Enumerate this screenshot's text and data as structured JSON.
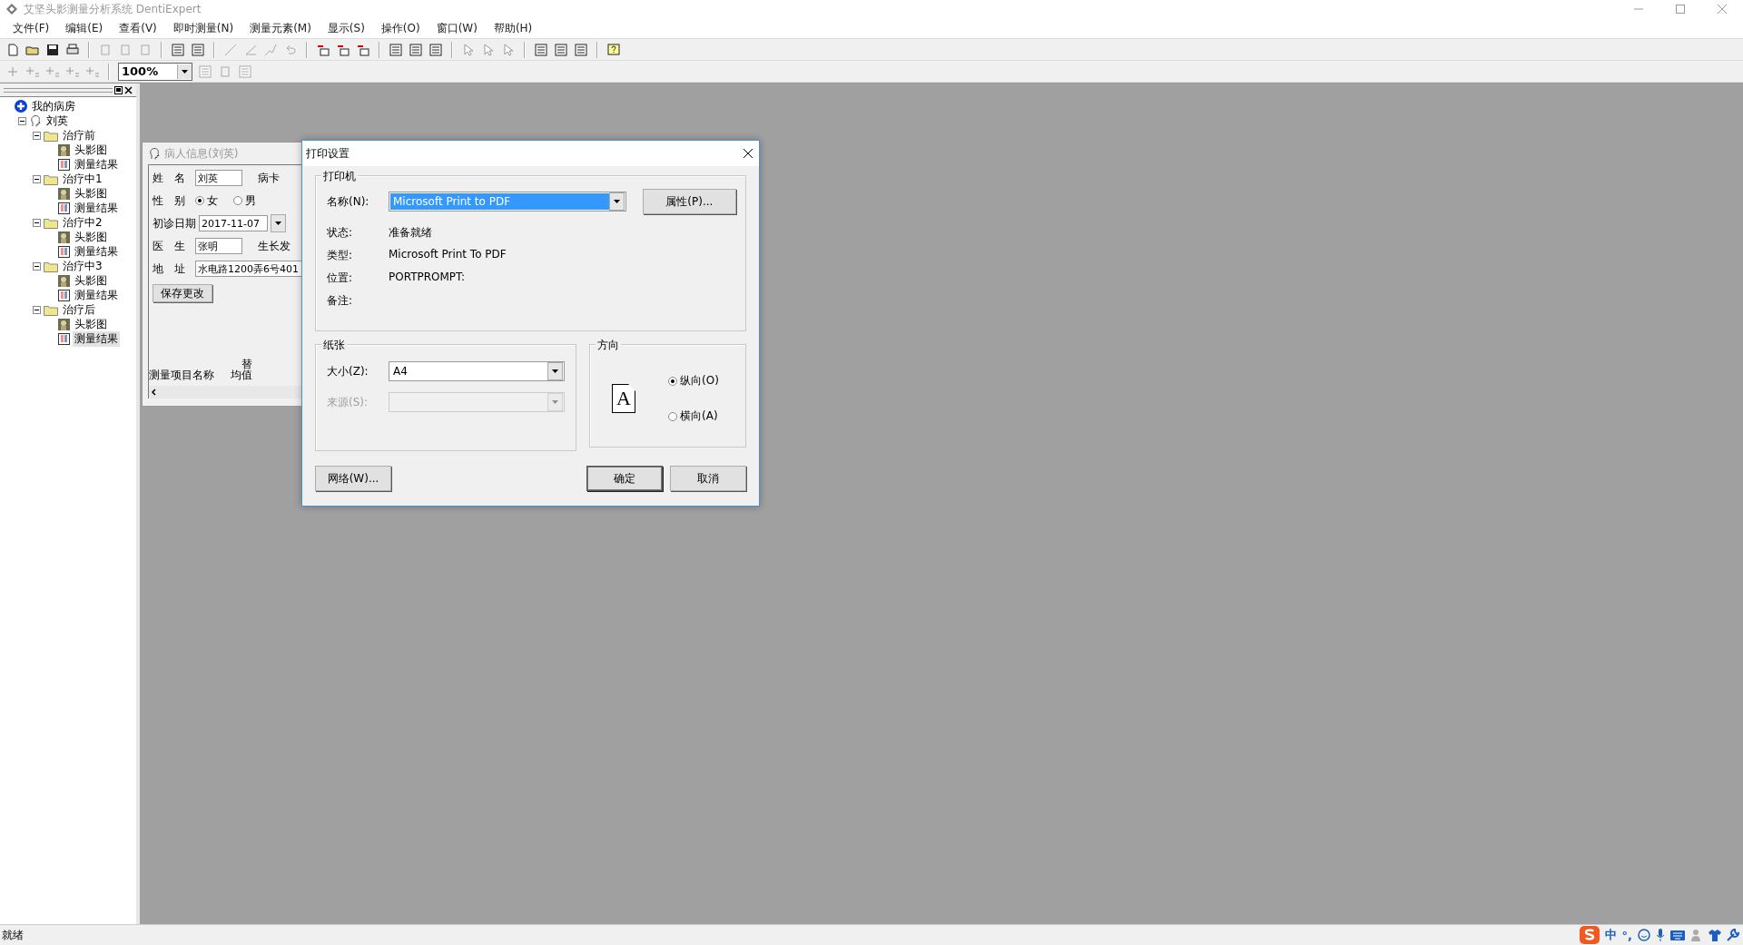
{
  "app": {
    "title": "艾坚头影测量分析系统 DentiExpert"
  },
  "menu": [
    "文件(F)",
    "编辑(E)",
    "查看(V)",
    "即时测量(N)",
    "测量元素(M)",
    "显示(S)",
    "操作(O)",
    "窗口(W)",
    "帮助(H)"
  ],
  "zoom": {
    "value": "100%"
  },
  "tree": [
    {
      "label": "我的病房",
      "kind": "root",
      "selected": false,
      "children": [
        {
          "label": "刘英",
          "kind": "patient",
          "selected": false,
          "children": [
            {
              "label": "治疗前",
              "kind": "folder",
              "selected": false,
              "children": [
                {
                  "label": "头影图",
                  "kind": "image",
                  "selected": false
                },
                {
                  "label": "测量结果",
                  "kind": "report",
                  "selected": false
                }
              ]
            },
            {
              "label": "治疗中1",
              "kind": "folder",
              "selected": false,
              "children": [
                {
                  "label": "头影图",
                  "kind": "image",
                  "selected": false
                },
                {
                  "label": "测量结果",
                  "kind": "report",
                  "selected": false
                }
              ]
            },
            {
              "label": "治疗中2",
              "kind": "folder",
              "selected": false,
              "children": [
                {
                  "label": "头影图",
                  "kind": "image",
                  "selected": false
                },
                {
                  "label": "测量结果",
                  "kind": "report",
                  "selected": false
                }
              ]
            },
            {
              "label": "治疗中3",
              "kind": "folder",
              "selected": false,
              "children": [
                {
                  "label": "头影图",
                  "kind": "image",
                  "selected": false
                },
                {
                  "label": "测量结果",
                  "kind": "report",
                  "selected": false
                }
              ]
            },
            {
              "label": "治疗后",
              "kind": "folder",
              "selected": false,
              "children": [
                {
                  "label": "头影图",
                  "kind": "image",
                  "selected": false
                },
                {
                  "label": "测量结果",
                  "kind": "report",
                  "selected": true
                }
              ]
            }
          ]
        }
      ]
    }
  ],
  "patient_window": {
    "title": "病人信息(刘英)",
    "rows": [
      {
        "kind": "text",
        "label": "姓　名",
        "value": "刘英",
        "extra": "病卡"
      },
      {
        "kind": "radio",
        "label": "性　别",
        "options": [
          {
            "label": "女",
            "selected": true
          },
          {
            "label": "男",
            "selected": false
          }
        ]
      },
      {
        "kind": "date",
        "label": "初诊日期",
        "value": "2017-11-07"
      },
      {
        "kind": "text",
        "label": "医　生",
        "value": "张明",
        "extra": "生长发"
      },
      {
        "kind": "wide",
        "label": "地　址",
        "value": "水电路1200弄6号401"
      }
    ],
    "save_button": "保存更改",
    "columns": [
      {
        "lines": [
          "测量项目名称"
        ]
      },
      {
        "lines": [
          "替",
          "均值"
        ]
      }
    ]
  },
  "dialog": {
    "title": "打印设置",
    "printer": {
      "title": "打印机",
      "name_label": "名称(N):",
      "name_value": "Microsoft Print to PDF",
      "properties_button": "属性(P)...",
      "info": [
        {
          "label": "状态:",
          "value": "准备就绪"
        },
        {
          "label": "类型:",
          "value": "Microsoft Print To PDF"
        },
        {
          "label": "位置:",
          "value": "PORTPROMPT:"
        },
        {
          "label": "备注:"
        }
      ]
    },
    "paper": {
      "title": "纸张",
      "fields": [
        {
          "label": "大小(Z):",
          "value": "A4",
          "disabled": false
        },
        {
          "label": "来源(S):",
          "disabled": true
        }
      ]
    },
    "orientation": {
      "title": "方向",
      "preview_letter": "A",
      "options": [
        {
          "label": "纵向(O)",
          "selected": true
        },
        {
          "label": "横向(A)",
          "selected": false
        }
      ]
    },
    "network_button": "网络(W)...",
    "buttons": [
      {
        "label": "确定",
        "default": true
      },
      {
        "label": "取消",
        "default": false
      }
    ]
  },
  "status_bar": {
    "text": "就绪"
  },
  "tray": [
    "中",
    "°,"
  ]
}
